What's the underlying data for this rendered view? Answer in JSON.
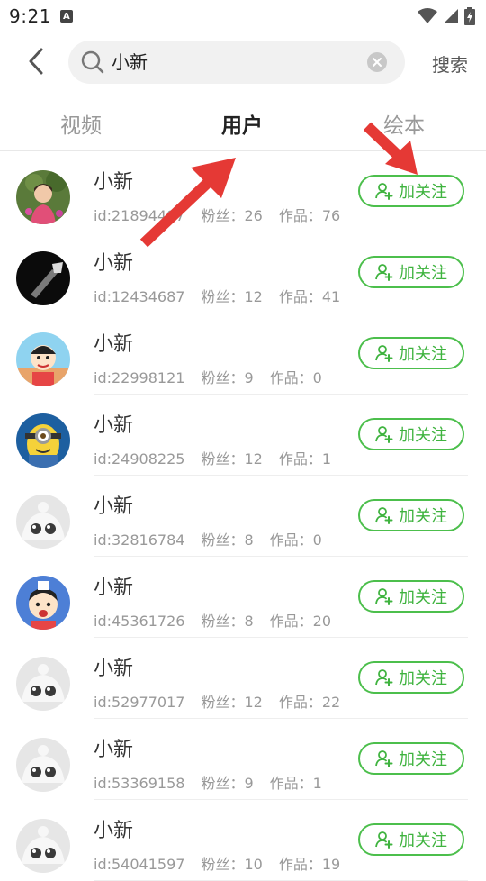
{
  "status_bar": {
    "time": "9:21",
    "app_icon_letter": "A",
    "icons": [
      "wifi-icon",
      "signal-icon",
      "battery-icon"
    ]
  },
  "search": {
    "back_icon": "chevron-left-icon",
    "query": "小新",
    "clear_icon": "clear-circle-icon",
    "search_label": "搜索"
  },
  "tabs": [
    {
      "label": "视频",
      "active": false
    },
    {
      "label": "用户",
      "active": true
    },
    {
      "label": "绘本",
      "active": false
    }
  ],
  "follow_label": "加关注",
  "fans_prefix": "粉丝：",
  "works_prefix": "作品：",
  "users": [
    {
      "name": "小新",
      "id": "id:21894497",
      "fans": "26",
      "works": "76",
      "avatar": "photo-girl"
    },
    {
      "name": "小新",
      "id": "id:12434687",
      "fans": "12",
      "works": "41",
      "avatar": "dark-tool"
    },
    {
      "name": "小新",
      "id": "id:22998121",
      "fans": "9",
      "works": "0",
      "avatar": "cartoon-shinchan"
    },
    {
      "name": "小新",
      "id": "id:24908225",
      "fans": "12",
      "works": "1",
      "avatar": "minion"
    },
    {
      "name": "小新",
      "id": "id:32816784",
      "fans": "8",
      "works": "0",
      "avatar": "default"
    },
    {
      "name": "小新",
      "id": "id:45361726",
      "fans": "8",
      "works": "20",
      "avatar": "cartoon-shinchan-blue"
    },
    {
      "name": "小新",
      "id": "id:52977017",
      "fans": "12",
      "works": "22",
      "avatar": "default"
    },
    {
      "name": "小新",
      "id": "id:53369158",
      "fans": "9",
      "works": "1",
      "avatar": "default"
    },
    {
      "name": "小新",
      "id": "id:54041597",
      "fans": "10",
      "works": "19",
      "avatar": "default"
    }
  ],
  "colors": {
    "accent_green": "#3fb33f",
    "annotation_red": "#e53935"
  }
}
